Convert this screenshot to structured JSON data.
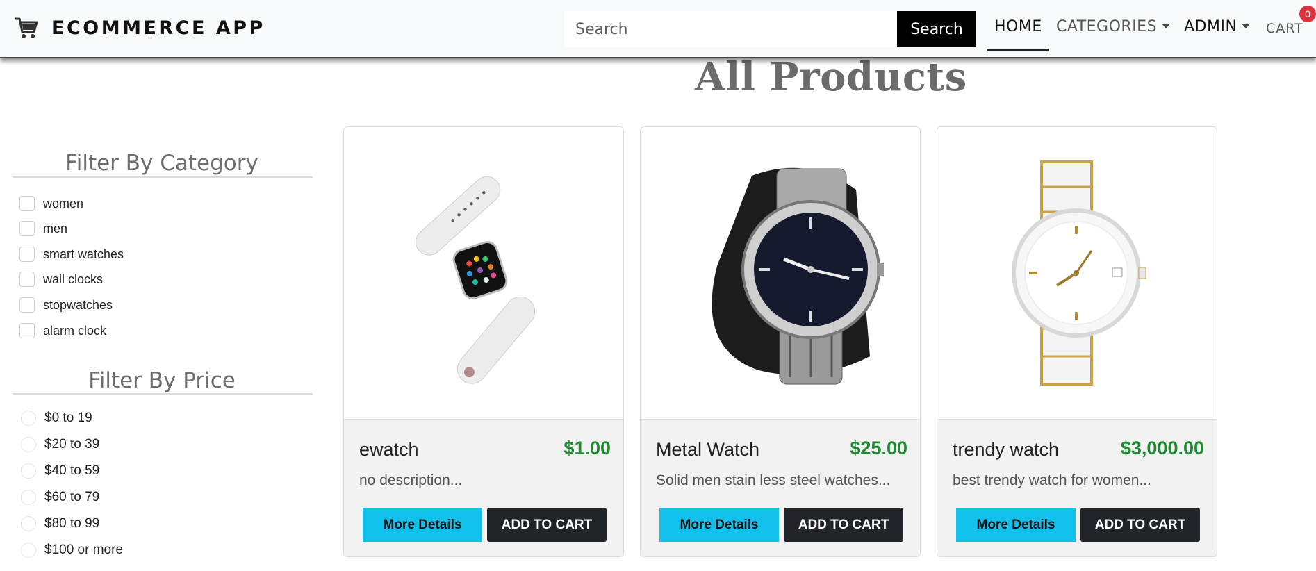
{
  "navbar": {
    "brand": "ECOMMERCE APP",
    "search_placeholder": "Search",
    "search_button": "Search",
    "links": {
      "home": "HOME",
      "categories": "CATEGORIES",
      "admin": "ADMIN",
      "cart": "CART"
    },
    "cart_count": "0"
  },
  "page_title": "All Products",
  "filters": {
    "category_title": "Filter By Category",
    "categories": [
      "women",
      "men",
      "smart watches",
      "wall clocks",
      "stopwatches",
      "alarm clock"
    ],
    "price_title": "Filter By Price",
    "prices": [
      "$0 to 19",
      "$20 to 39",
      "$40 to 59",
      "$60 to 79",
      "$80 to 99",
      "$100 or more"
    ]
  },
  "products": [
    {
      "name": "ewatch",
      "price": "$1.00",
      "description": "no description...",
      "details_label": "More Details",
      "cart_label": "ADD TO CART"
    },
    {
      "name": "Metal Watch",
      "price": "$25.00",
      "description": "Solid men stain less steel watches...",
      "details_label": "More Details",
      "cart_label": "ADD TO CART"
    },
    {
      "name": "trendy watch",
      "price": "$3,000.00",
      "description": "best trendy watch for women...",
      "details_label": "More Details",
      "cart_label": "ADD TO CART"
    }
  ],
  "colors": {
    "price_green": "#1f8a32",
    "details_button": "#12c0ec",
    "cart_button": "#212529",
    "badge": "#e0323c"
  }
}
